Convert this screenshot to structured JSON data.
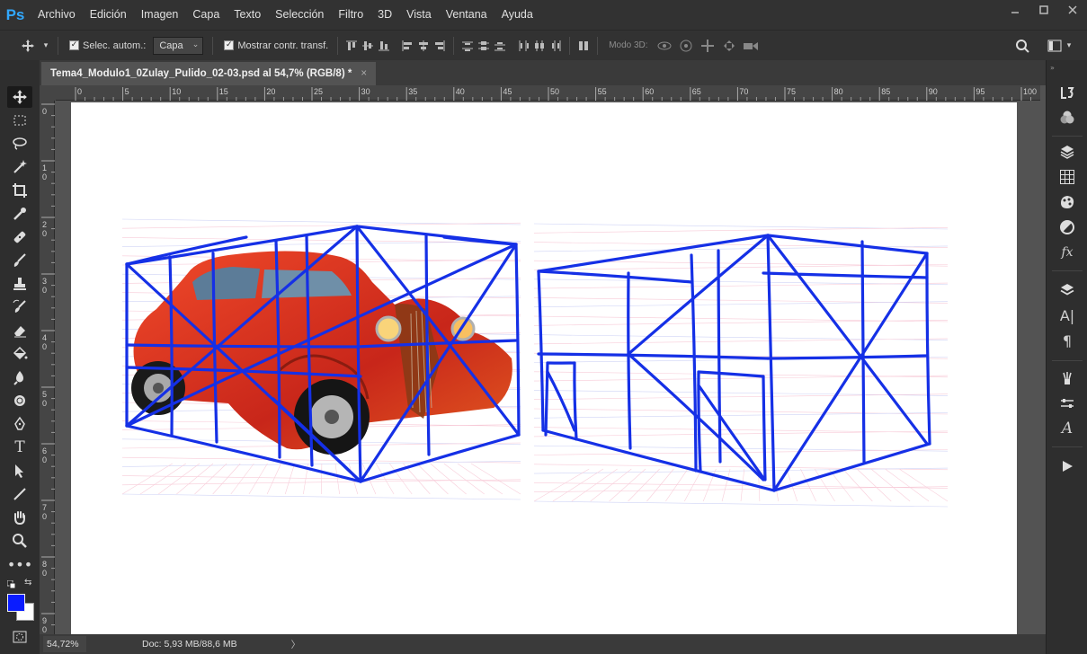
{
  "app": {
    "logo": "Ps"
  },
  "menu": [
    "Archivo",
    "Edición",
    "Imagen",
    "Capa",
    "Texto",
    "Selección",
    "Filtro",
    "3D",
    "Vista",
    "Ventana",
    "Ayuda"
  ],
  "options": {
    "auto_select_label": "Selec. autom.:",
    "auto_select_value": "Capa",
    "show_transform_label": "Mostrar contr. transf.",
    "mode3d_label": "Modo 3D:"
  },
  "document": {
    "tab_title": "Tema4_Modulo1_0Zulay_Pulido_02-03.psd al 54,7% (RGB/8) *",
    "close_glyph": "×"
  },
  "rulers": {
    "horizontal": [
      "0",
      "5",
      "10",
      "15",
      "20",
      "25",
      "30",
      "35",
      "40",
      "45",
      "50",
      "55",
      "60",
      "65",
      "70",
      "75",
      "80",
      "85",
      "90",
      "95",
      "100"
    ],
    "vertical": [
      "0",
      "1 0",
      "2 0",
      "3 0",
      "4 0",
      "5 0",
      "6 0",
      "7 0",
      "8 0",
      "9 0"
    ]
  },
  "status": {
    "zoom": "54,72%",
    "doc_info": "Doc: 5,93 MB/88,6 MB",
    "arrow": "〉"
  },
  "colors": {
    "foreground": "#0a1cff",
    "background": "#ffffff",
    "sketch_blue": "#1530e6",
    "car_red": "#d8321c"
  },
  "icons": {
    "tools": [
      "move-icon",
      "marquee-icon",
      "lasso-icon",
      "magic-wand-icon",
      "crop-icon",
      "eyedropper-icon",
      "healing-icon",
      "brush-icon",
      "stamp-icon",
      "history-brush-icon",
      "eraser-icon",
      "bucket-icon",
      "blur-icon",
      "dodge-icon",
      "pen-icon",
      "type-icon",
      "path-select-icon",
      "line-icon",
      "hand-icon",
      "zoom-icon",
      "more-icon"
    ],
    "dock": [
      "history-icon",
      "color-icon",
      "libraries-icon",
      "swatches-icon",
      "styles-icon",
      "adjustments-icon",
      "fx-icon",
      "layers-icon",
      "character-icon",
      "paragraph-icon",
      "brushes-icon",
      "properties-icon",
      "glyphs-icon",
      "play-icon"
    ]
  }
}
